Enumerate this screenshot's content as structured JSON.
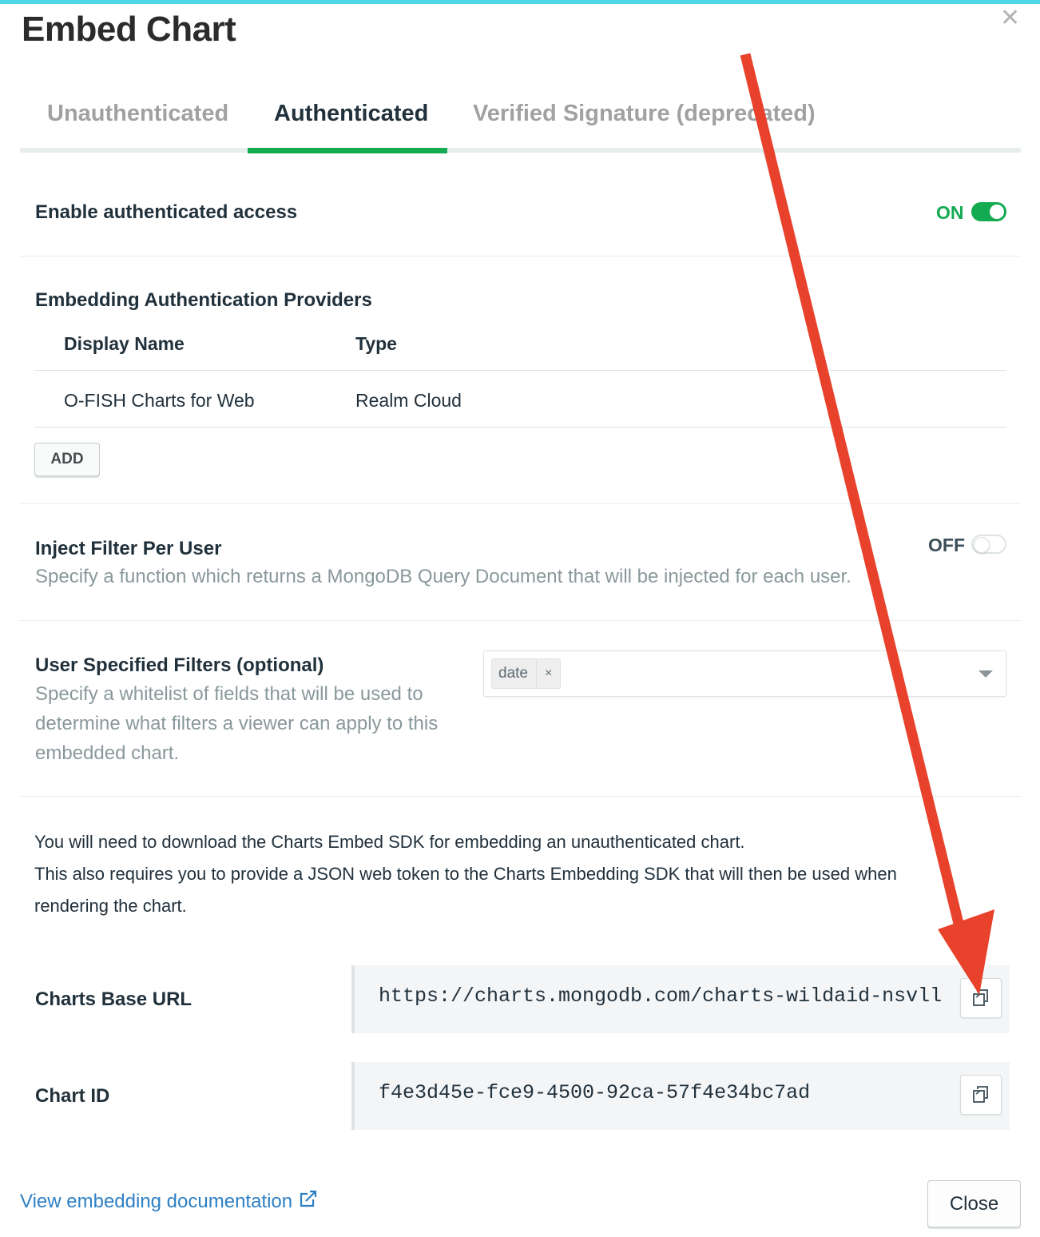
{
  "modal": {
    "title": "Embed Chart"
  },
  "tabs": [
    {
      "label": "Unauthenticated",
      "active": false
    },
    {
      "label": "Authenticated",
      "active": true
    },
    {
      "label": "Verified Signature (deprecated)",
      "active": false
    }
  ],
  "auth_access": {
    "label": "Enable authenticated access",
    "state_text": "ON",
    "enabled": true
  },
  "providers": {
    "heading": "Embedding Authentication Providers",
    "columns": [
      "Display Name",
      "Type"
    ],
    "rows": [
      {
        "display_name": "O-FISH Charts for Web",
        "type": "Realm Cloud"
      }
    ],
    "add_label": "ADD"
  },
  "inject_filter": {
    "label": "Inject Filter Per User",
    "description": "Specify a function which returns a MongoDB Query Document that will be injected for each user.",
    "state_text": "OFF",
    "enabled": false
  },
  "user_filters": {
    "label": "User Specified Filters (optional)",
    "description_lines": [
      "Specify a whitelist of fields that will be used to",
      "determine what filters a viewer can apply to this",
      "embedded chart."
    ],
    "selected": [
      {
        "label": "date",
        "remove": "×"
      }
    ]
  },
  "info": {
    "lines": [
      "You will need to download the Charts Embed SDK for embedding an unauthenticated chart.",
      "This also requires you to provide a JSON web token to the Charts Embedding SDK that will then be used when",
      "rendering the chart."
    ]
  },
  "base_url": {
    "label": "Charts Base URL",
    "value": "https://charts.mongodb.com/charts-wildaid-nsvll"
  },
  "chart_id": {
    "label": "Chart ID",
    "value": "f4e3d45e-fce9-4500-92ca-57f4e34bc7ad"
  },
  "footer": {
    "doc_link": "View embedding documentation",
    "close_label": "Close"
  },
  "colors": {
    "accent_green": "#13aa52",
    "link_blue": "#2e80c4",
    "annotation_red": "#e8412c"
  },
  "icons": {
    "close": "close-icon",
    "copy": "copy-icon",
    "external_link": "external-link-icon",
    "dropdown": "chevron-down-icon"
  }
}
